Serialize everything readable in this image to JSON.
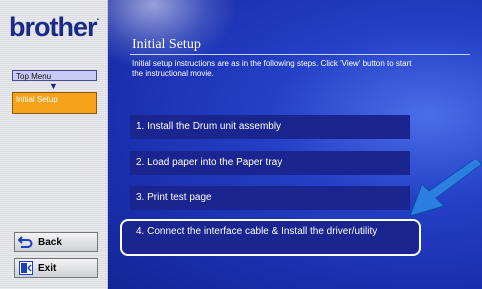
{
  "brand": {
    "logo": "brother",
    "logo_dot": "."
  },
  "sidebar": {
    "top_menu": "Top Menu",
    "arrow": "▼",
    "current": "Initial Setup",
    "back_label": "Back",
    "exit_label": "Exit"
  },
  "main": {
    "title": "Initial Setup",
    "intro": "Initial setup instructions are as in the following steps. Click 'View' button to start the instructional movie.",
    "steps": [
      "1. Install the Drum unit assembly",
      "2. Load paper into the Paper tray",
      "3. Print test page",
      "4. Connect the interface cable & Install the driver/utility"
    ]
  },
  "colors": {
    "brand_blue": "#1a2a86",
    "main_blue": "#2440c6",
    "step_bg": "#1a2590",
    "nav_highlight": "#f5a21a",
    "pointer": "#2a7fe0"
  }
}
